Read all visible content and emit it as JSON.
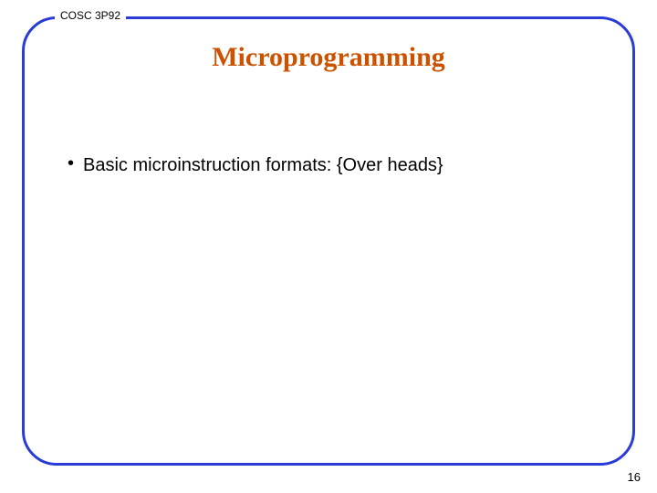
{
  "header": {
    "course_code": "COSC 3P92"
  },
  "slide": {
    "title": "Microprogramming",
    "bullets": [
      {
        "text": "Basic microinstruction formats: {Over heads}"
      }
    ]
  },
  "footer": {
    "page_number": "16"
  }
}
